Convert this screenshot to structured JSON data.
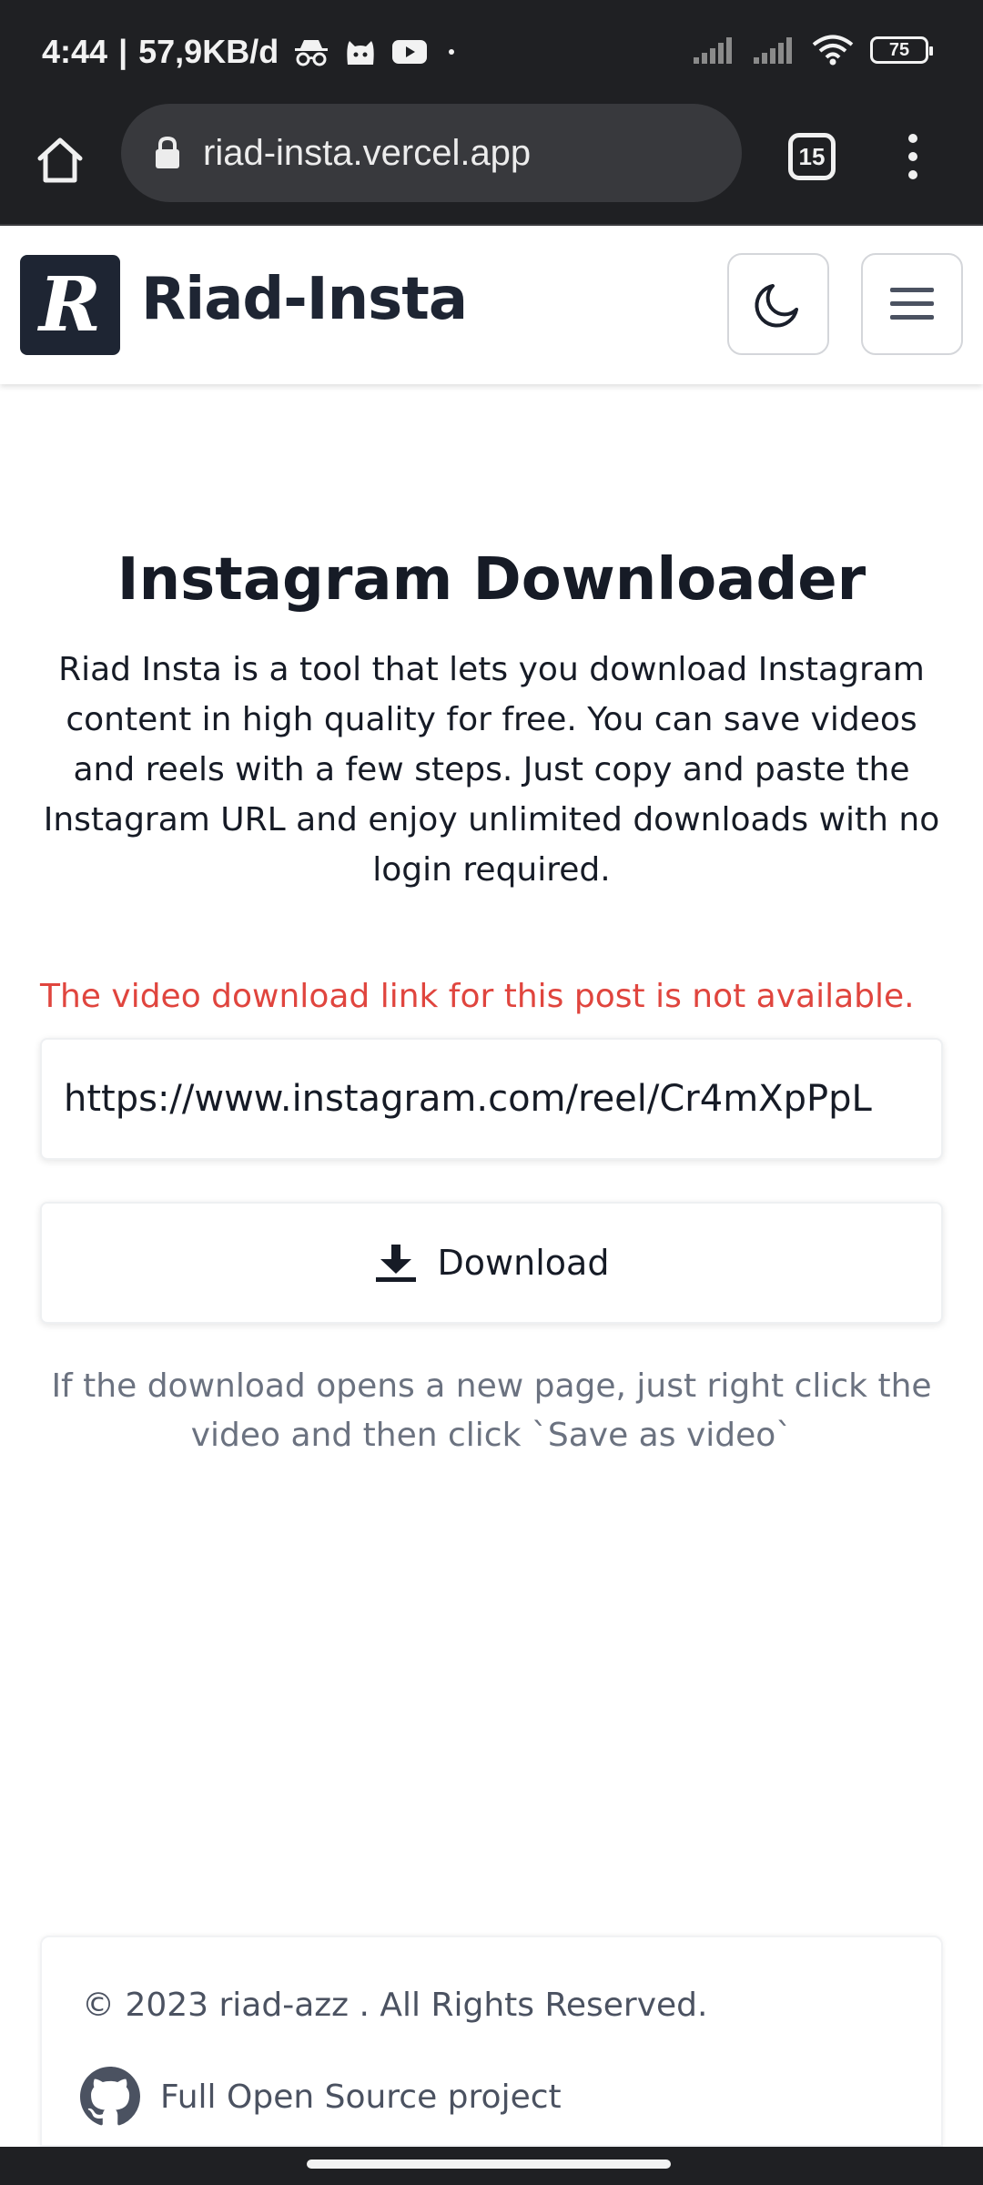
{
  "status_bar": {
    "time": "4:44",
    "network_speed": "57,9KB/d",
    "battery": "75"
  },
  "browser": {
    "url": "riad-insta.vercel.app",
    "tab_count": "15"
  },
  "header": {
    "logo_letter": "R",
    "brand": "Riad-Insta"
  },
  "main": {
    "title": "Instagram Downloader",
    "intro": "Riad Insta is a tool that lets you download Instagram content in high quality for free. You can save videos and reels with a few steps. Just copy and paste the Instagram URL and enjoy unlimited downloads with no login required.",
    "error": "The video download link for this post is not available.",
    "url_value": "https://www.instagram.com/reel/Cr4mXpPpL",
    "download_label": "Download",
    "hint": "If the download opens a new page, just right click the video and then click `Save as video`"
  },
  "footer": {
    "copyright": "© 2023 riad-azz . All Rights Reserved.",
    "open_source": "Full Open Source project"
  }
}
